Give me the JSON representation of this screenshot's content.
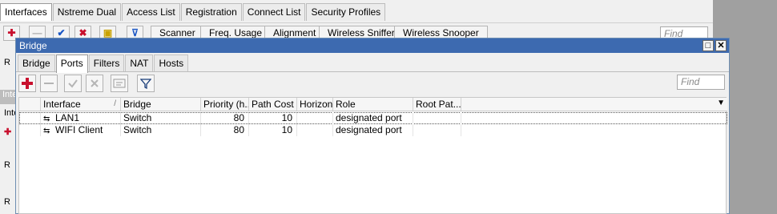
{
  "background_window": {
    "tabs": [
      {
        "label": "Interfaces",
        "active": true
      },
      {
        "label": "Nstreme Dual",
        "active": false
      },
      {
        "label": "Access List",
        "active": false
      },
      {
        "label": "Registration",
        "active": false
      },
      {
        "label": "Connect List",
        "active": false
      },
      {
        "label": "Security Profiles",
        "active": false
      }
    ],
    "toolbar_buttons": [
      "Scanner",
      "Freq. Usage",
      "Alignment",
      "Wireless Sniffer",
      "Wireless Snooper"
    ],
    "find_placeholder": "Find",
    "side_labels": [
      "R",
      "Inte",
      "Inte",
      "R",
      "R"
    ]
  },
  "bridge_window": {
    "title": "Bridge",
    "tabs": [
      {
        "label": "Bridge",
        "active": false
      },
      {
        "label": "Ports",
        "active": true
      },
      {
        "label": "Filters",
        "active": false
      },
      {
        "label": "NAT",
        "active": false
      },
      {
        "label": "Hosts",
        "active": false
      }
    ],
    "find_placeholder": "Find",
    "columns": [
      "Interface",
      "Bridge",
      "Priority (h...",
      "Path Cost",
      "Horizon",
      "Role",
      "Root Pat..."
    ],
    "sorted_column_indicator": "/",
    "rows": [
      {
        "interface": "LAN1",
        "bridge": "Switch",
        "priority": "80",
        "path_cost": "10",
        "horizon": "",
        "role": "designated port",
        "root_path_cost": ""
      },
      {
        "interface": "WIFI Client",
        "bridge": "Switch",
        "priority": "80",
        "path_cost": "10",
        "horizon": "",
        "role": "designated port",
        "root_path_cost": ""
      }
    ]
  },
  "colors": {
    "titlebar": "#3d6ab0",
    "add_icon": "#c8102e",
    "window_bg": "#f0f0f0"
  },
  "icons": {
    "add": "plus-icon",
    "remove": "minus-icon",
    "enable": "check-icon",
    "disable": "cross-icon",
    "comment": "note-icon",
    "filter": "filter-icon",
    "interface": "bridge-port-icon"
  }
}
